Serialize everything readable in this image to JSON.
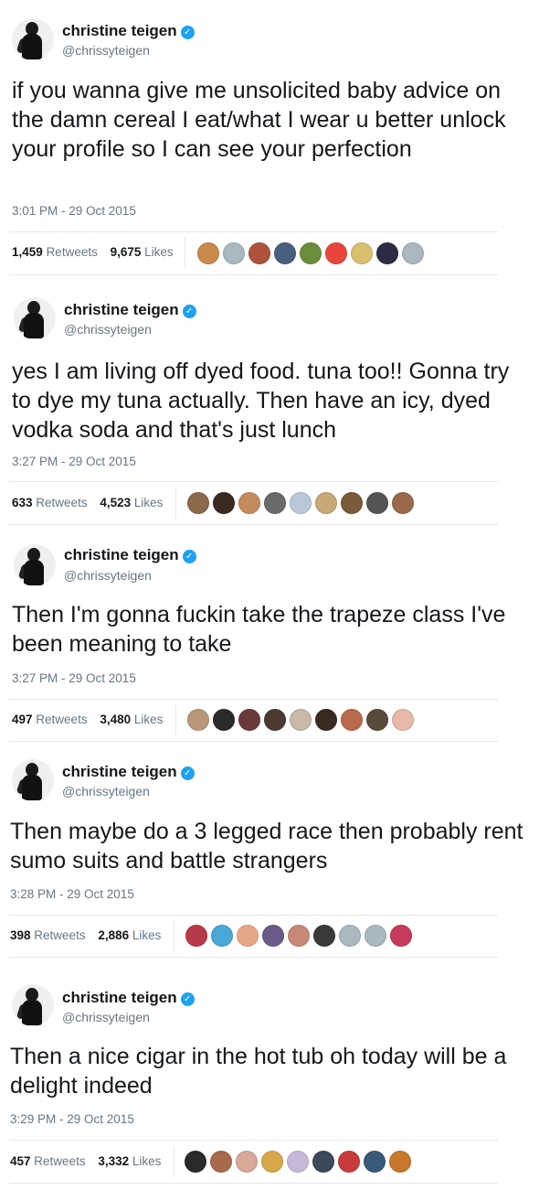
{
  "author": {
    "name": "christine teigen",
    "handle": "@chrissyteigen",
    "verified_glyph": "✓"
  },
  "tweets": [
    {
      "text": "if you wanna give me unsolicited baby advice on the damn cereal I eat/what I wear u better unlock your profile so I can see your perfection",
      "time": "3:01 PM - 29 Oct 2015",
      "retweets": "1,459",
      "retweets_label": "Retweets",
      "likes": "9,675",
      "likes_label": "Likes",
      "liker_colors": [
        "#c98a4b",
        "#aab8c2",
        "#b0533c",
        "#4a5f80",
        "#6b8e3d",
        "#e8463c",
        "#d9c070",
        "#2c2c44",
        "#aab8c2"
      ]
    },
    {
      "text": "yes I am living off dyed food. tuna too!! Gonna try to dye my tuna actually. Then have an icy, dyed vodka soda and that's just lunch",
      "time": "3:27 PM - 29 Oct 2015",
      "retweets": "633",
      "retweets_label": "Retweets",
      "likes": "4,523",
      "likes_label": "Likes",
      "liker_colors": [
        "#8a6a4a",
        "#3a2a20",
        "#c48c5c",
        "#6a6a6a",
        "#b8c8d8",
        "#c8a878",
        "#7a5a3a",
        "#555555",
        "#9a6a4a"
      ]
    },
    {
      "text": "Then I'm gonna fuckin take the trapeze class I've been meaning to take",
      "time": "3:27 PM - 29 Oct 2015",
      "retweets": "497",
      "retweets_label": "Retweets",
      "likes": "3,480",
      "likes_label": "Likes",
      "liker_colors": [
        "#b89878",
        "#2a2a2a",
        "#6a3a3a",
        "#4a3a30",
        "#c8b8a8",
        "#3a2a20",
        "#b86a4a",
        "#5a4a3a",
        "#e8b8a8"
      ]
    },
    {
      "text": "Then maybe do a 3 legged race then probably rent sumo suits and battle strangers",
      "time": "3:28 PM - 29 Oct 2015",
      "retweets": "398",
      "retweets_label": "Retweets",
      "likes": "2,886",
      "likes_label": "Likes",
      "liker_colors": [
        "#b83a4a",
        "#4aa8d8",
        "#e8a888",
        "#6a5a8a",
        "#c88878",
        "#3a3a3a",
        "#aab8c2",
        "#aab8c2",
        "#c83a5a"
      ]
    },
    {
      "text": "Then a nice cigar in the hot tub oh today will be a delight indeed",
      "time": "3:29 PM - 29 Oct 2015",
      "retweets": "457",
      "retweets_label": "Retweets",
      "likes": "3,332",
      "likes_label": "Likes",
      "liker_colors": [
        "#2a2a2a",
        "#a86a4a",
        "#d8a898",
        "#d8a848",
        "#c8b8d8",
        "#3a4a5a",
        "#c83a3a",
        "#3a5a7a",
        "#c8782a"
      ]
    }
  ]
}
